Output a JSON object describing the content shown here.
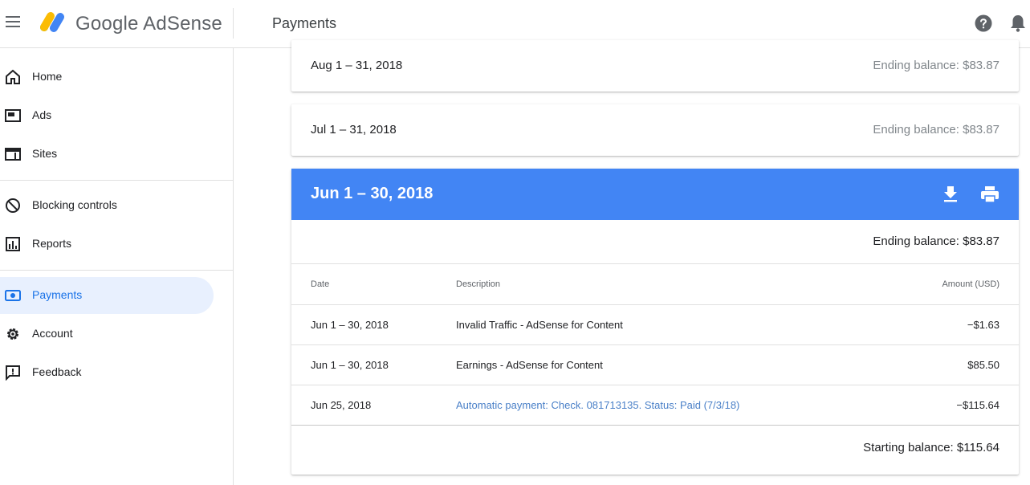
{
  "header": {
    "brand": "Google AdSense",
    "page_title": "Payments"
  },
  "sidebar": {
    "items": [
      {
        "label": "Home",
        "icon": "home-icon"
      },
      {
        "label": "Ads",
        "icon": "ads-icon"
      },
      {
        "label": "Sites",
        "icon": "sites-icon"
      },
      {
        "label": "Blocking controls",
        "icon": "block-icon"
      },
      {
        "label": "Reports",
        "icon": "reports-icon"
      },
      {
        "label": "Payments",
        "icon": "payments-icon",
        "active": true
      },
      {
        "label": "Account",
        "icon": "gear-icon"
      },
      {
        "label": "Feedback",
        "icon": "feedback-icon"
      }
    ]
  },
  "statements": [
    {
      "period": "Aug 1 – 31, 2018",
      "ending": "Ending balance: $83.87"
    },
    {
      "period": "Jul 1 – 31, 2018",
      "ending": "Ending balance: $83.87"
    }
  ],
  "expanded": {
    "period": "Jun 1 – 30, 2018",
    "ending": "Ending balance: $83.87",
    "columns": {
      "date": "Date",
      "description": "Description",
      "amount": "Amount (USD)"
    },
    "rows": [
      {
        "date": "Jun 1 – 30, 2018",
        "description": "Invalid Traffic - AdSense for Content",
        "amount": "−$1.63"
      },
      {
        "date": "Jun 1 – 30, 2018",
        "description": "Earnings - AdSense for Content",
        "amount": "$85.50"
      },
      {
        "date": "Jun 25, 2018",
        "description": "Automatic payment: Check. 081713135. Status: Paid (7/3/18)",
        "amount": "−$115.64"
      }
    ],
    "starting": "Starting balance: $115.64"
  },
  "colors": {
    "accent_blue": "#4285f4",
    "active_nav_bg": "#e8f0fe",
    "active_nav_text": "#1a73e8",
    "link": "#4a80c8"
  }
}
